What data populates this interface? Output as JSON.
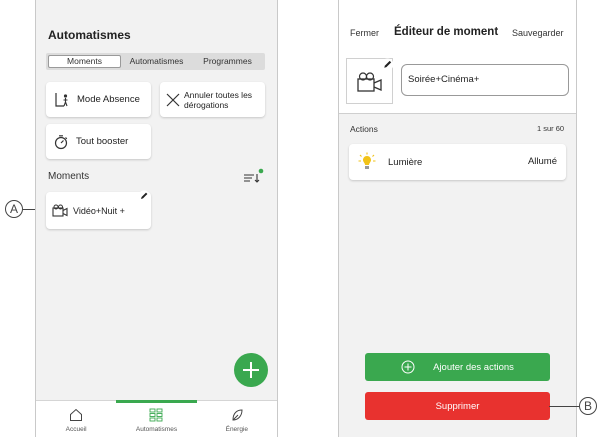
{
  "left_screen": {
    "title": "Automatismes",
    "tabs": [
      {
        "label": "Moments",
        "active": true
      },
      {
        "label": "Automatismes",
        "active": false
      },
      {
        "label": "Programmes",
        "active": false
      }
    ],
    "quick_actions": {
      "mode_absence": "Mode Absence",
      "cancel_overrides": "Annuler toutes les dérogations",
      "boost_all": "Tout booster"
    },
    "moments_heading": "Moments",
    "moment_card": "Vidéo+Nuit +",
    "nav": [
      {
        "label": "Accueil",
        "icon": "home-icon"
      },
      {
        "label": "Automatismes",
        "icon": "grid-icon",
        "active": true
      },
      {
        "label": "Énergie",
        "icon": "leaf-icon"
      }
    ]
  },
  "right_screen": {
    "close": "Fermer",
    "title": "Éditeur de moment",
    "save": "Sauvegarder",
    "moment_name": "Soirée+Cinéma+",
    "actions_label": "Actions",
    "actions_count": "1 sur 60",
    "action": {
      "name": "Lumière",
      "state": "Allumé"
    },
    "add_button": "Ajouter des actions",
    "delete_button": "Supprimer"
  },
  "callouts": {
    "a": "A",
    "b": "B"
  },
  "colors": {
    "accent_green": "#3aa84f",
    "danger_red": "#e8322f",
    "bulb_yellow": "#f2c318"
  }
}
